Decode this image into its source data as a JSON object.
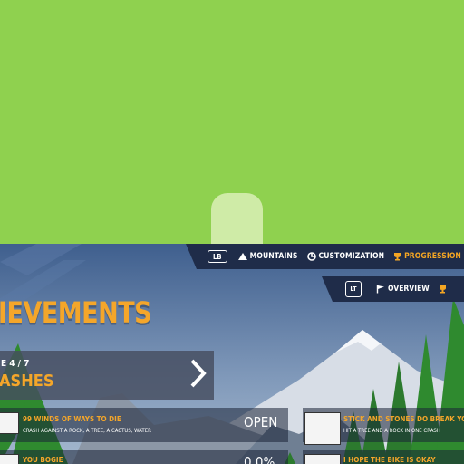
{
  "overlay": {
    "touch": "touch-indicator"
  },
  "top_nav": {
    "button_hint": "LB",
    "tabs": [
      {
        "label": "MOUNTAINS",
        "icon": "mountain-icon",
        "active": false
      },
      {
        "label": "CUSTOMIZATION",
        "icon": "customization-icon",
        "active": false
      },
      {
        "label": "PROGRESSION",
        "icon": "trophy-icon",
        "active": true
      }
    ]
  },
  "sub_nav": {
    "button_hint": "LT",
    "tabs": [
      {
        "label": "OVERVIEW",
        "icon": "flag-icon"
      },
      {
        "label": "",
        "icon": "trophy-icon"
      }
    ]
  },
  "page": {
    "title": "IEVEMENTS"
  },
  "category": {
    "counter": "E 4 / 7",
    "name": "ASHES"
  },
  "achievements": [
    {
      "title": "99 WINDS OF WAYS TO DIE",
      "description": "CRASH AGAINST A ROCK, A TREE, A CACTUS, WATER",
      "status": "OPEN"
    },
    {
      "title": "STICK AND STONES DO BREAK YOUR",
      "description": "HIT A TREE AND A ROCK IN ONE CRASH",
      "status": ""
    },
    {
      "title": "YOU BOGIE",
      "description": "",
      "status": "0.0%"
    },
    {
      "title": "I HOPE THE BIKE IS OKAY",
      "description": "",
      "status": ""
    }
  ],
  "colors": {
    "accent": "#f4a62a",
    "nav_bg": "#1f2c49",
    "green": "#8fd14f"
  }
}
